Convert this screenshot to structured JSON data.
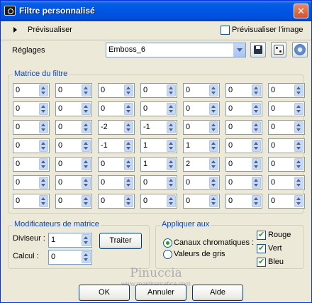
{
  "window": {
    "title": "Filtre personnalisé",
    "close_glyph": "✕",
    "app_icon": "camera-icon"
  },
  "preview": {
    "label": "Prévisualiser",
    "image_preview_label": "Prévisualiser l'image",
    "image_preview_checked": false
  },
  "settings": {
    "label": "Réglages",
    "preset_value": "Emboss_6",
    "save_icon": "save-icon",
    "random_icon": "dice-icon",
    "reset_icon": "reset-icon"
  },
  "matrix": {
    "legend": "Matrice du filtre",
    "rows": [
      [
        "0",
        "0",
        "0",
        "0",
        "0",
        "0",
        "0"
      ],
      [
        "0",
        "0",
        "0",
        "0",
        "0",
        "0",
        "0"
      ],
      [
        "0",
        "0",
        "-2",
        "-1",
        "0",
        "0",
        "0"
      ],
      [
        "0",
        "0",
        "-1",
        "1",
        "1",
        "0",
        "0"
      ],
      [
        "0",
        "0",
        "0",
        "1",
        "2",
        "0",
        "0"
      ],
      [
        "0",
        "0",
        "0",
        "0",
        "0",
        "0",
        "0"
      ],
      [
        "0",
        "0",
        "0",
        "0",
        "0",
        "0",
        "0"
      ]
    ]
  },
  "modifiers": {
    "legend": "Modificateurs de matrice",
    "divisor_label": "Diviseur :",
    "divisor_value": "1",
    "bias_label": "Calcul :",
    "bias_value": "0",
    "process_button": "Traiter"
  },
  "apply": {
    "legend": "Appliquer aux",
    "channels_label": "Canaux chromatiques :",
    "grayscale_label": "Valeurs de gris",
    "channels_selected": true,
    "red": "Rouge",
    "green": "Vert",
    "blue": "Bleu"
  },
  "watermark": {
    "name": "Pinuccia",
    "site": "www.maidiregrafica.com"
  },
  "buttons": {
    "ok": "OK",
    "cancel": "Annuler",
    "help": "Aide"
  },
  "colors": {
    "titlebar": "#0054e3",
    "background": "#ece9d8",
    "group_legend": "#0046d5",
    "check": "#21a121"
  }
}
